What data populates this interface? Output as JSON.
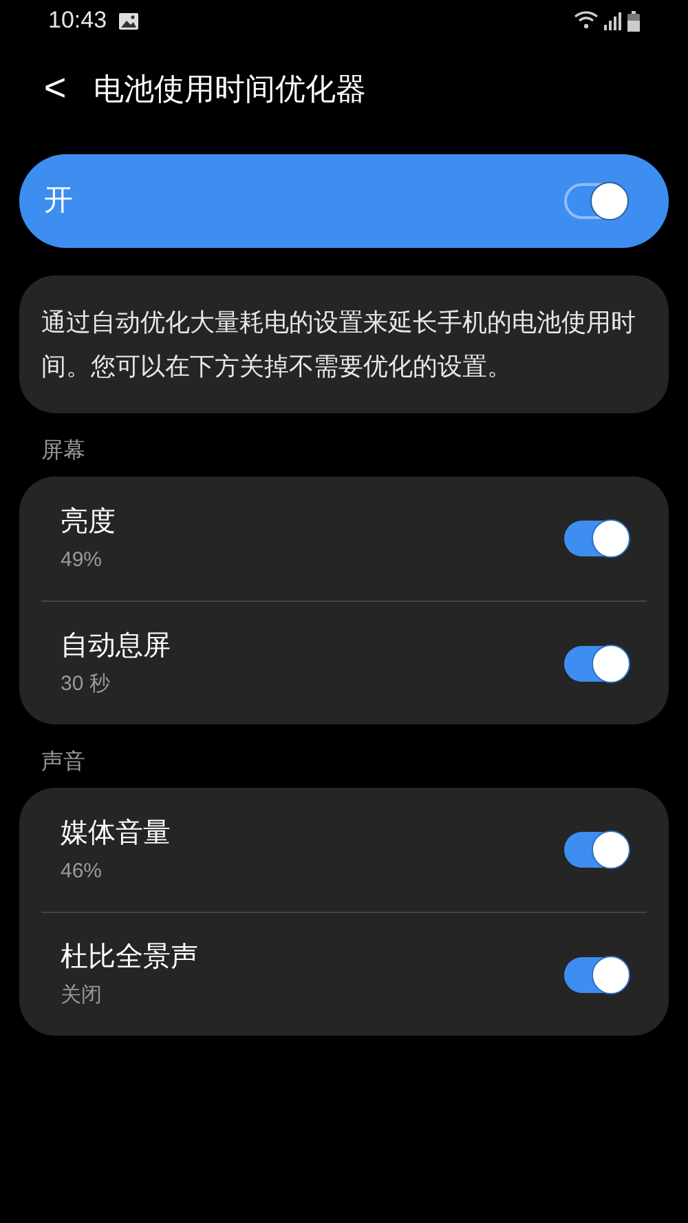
{
  "status_bar": {
    "time": "10:43"
  },
  "header": {
    "back": "<",
    "title": "电池使用时间优化器"
  },
  "master_switch": {
    "label": "开",
    "on": true
  },
  "description": "通过自动优化大量耗电的设置来延长手机的电池使用时间。您可以在下方关掉不需要优化的设置。",
  "sections": [
    {
      "title": "屏幕",
      "items": [
        {
          "label": "亮度",
          "value": "49%",
          "on": true
        },
        {
          "label": "自动息屏",
          "value": "30 秒",
          "on": true
        }
      ]
    },
    {
      "title": "声音",
      "items": [
        {
          "label": "媒体音量",
          "value": "46%",
          "on": true
        },
        {
          "label": "杜比全景声",
          "value": "关闭",
          "on": true
        }
      ]
    }
  ]
}
